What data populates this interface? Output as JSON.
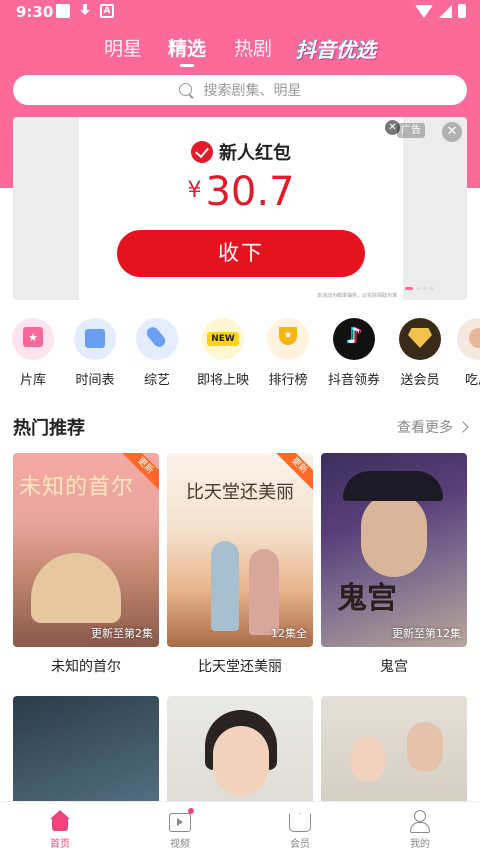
{
  "status_bar": {
    "time": "9:30"
  },
  "top_tabs": {
    "items": [
      "明星",
      "精选",
      "热剧"
    ],
    "active": "精选",
    "brand": "抖音优选"
  },
  "search": {
    "placeholder": "搜索剧集、明星"
  },
  "banner": {
    "title": "新人红包",
    "currency": "¥",
    "amount": "30.7",
    "button": "收下",
    "ad_label": "广告",
    "footnote": "本活动为概率抽奖，以实际领取为准"
  },
  "categories": [
    {
      "label": "片库",
      "icon": "film-library-icon"
    },
    {
      "label": "时间表",
      "icon": "calendar-icon"
    },
    {
      "label": "综艺",
      "icon": "microphone-icon"
    },
    {
      "label": "即将上映",
      "icon": "new-badge-icon"
    },
    {
      "label": "排行榜",
      "icon": "trophy-icon"
    },
    {
      "label": "抖音领券",
      "icon": "douyin-logo-icon"
    },
    {
      "label": "送会员",
      "icon": "diamond-icon"
    },
    {
      "label": "吃瓜",
      "icon": "melon-icon"
    }
  ],
  "section": {
    "title": "热门推荐",
    "more": "查看更多"
  },
  "dramas": [
    {
      "title": "未知的首尔",
      "note": "更新至第2集",
      "tag": "更新",
      "poster_text": "未知的首尔"
    },
    {
      "title": "比天堂还美丽",
      "note": "12集全",
      "tag": "更新",
      "poster_text": "比天堂还美丽"
    },
    {
      "title": "鬼宫",
      "note": "更新至第12集",
      "tag": "",
      "poster_text": "鬼宫"
    }
  ],
  "bottom_nav": [
    {
      "label": "首页",
      "icon": "home-icon",
      "active": true
    },
    {
      "label": "视频",
      "icon": "video-icon",
      "active": false
    },
    {
      "label": "会员",
      "icon": "vip-crown-icon",
      "active": false
    },
    {
      "label": "我的",
      "icon": "profile-icon",
      "active": false
    }
  ],
  "colors": {
    "brand_pink": "#fb6a99",
    "red_packet": "#e4141f",
    "nav_active": "#f0457c"
  }
}
